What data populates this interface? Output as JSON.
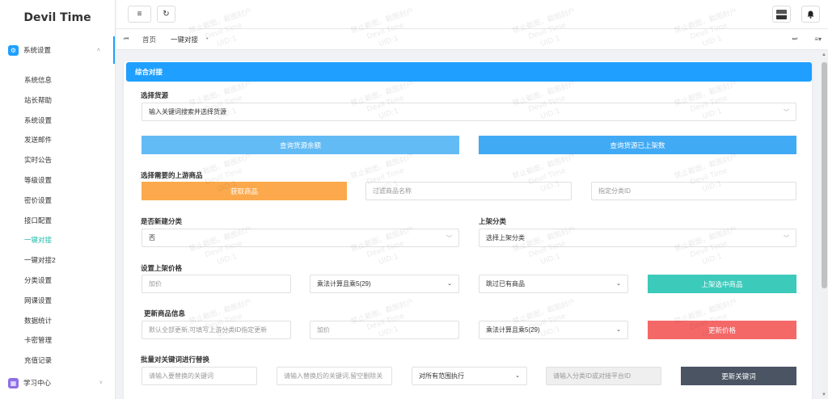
{
  "sidebar": {
    "brand": "Devil Time",
    "group_system": {
      "label": "系统设置",
      "icon": "gear-icon"
    },
    "items": [
      {
        "label": "系统信息"
      },
      {
        "label": "站长帮助"
      },
      {
        "label": "系统设置"
      },
      {
        "label": "发送邮件"
      },
      {
        "label": "实时公告"
      },
      {
        "label": "等级设置"
      },
      {
        "label": "密价设置"
      },
      {
        "label": "接口配置"
      },
      {
        "label": "一键对接",
        "active": true
      },
      {
        "label": "一键对接2"
      },
      {
        "label": "分类设置"
      },
      {
        "label": "网课设置"
      },
      {
        "label": "数据统计"
      },
      {
        "label": "卡密管理"
      },
      {
        "label": "充值记录"
      }
    ],
    "group_learning": {
      "label": "学习中心",
      "icon": "grid-icon"
    }
  },
  "header": {
    "menu_icon": "≡",
    "refresh_icon": "↻"
  },
  "tabs": {
    "home": "首页",
    "current": "一键对接",
    "close": "•",
    "prev_icon": "⏮",
    "next_icon": "⏭",
    "more_icon": "≡▾"
  },
  "panel": {
    "title": "综合对接",
    "source": {
      "label": "选择货源",
      "value": "输入关键词搜索并选择货源",
      "btn_balance": "查询货源余额",
      "btn_listed": "查询货源已上架数"
    },
    "upstream": {
      "label": "选择需要的上游商品",
      "btn_fetch": "获取商品",
      "filter_placeholder": "过滤商品名称",
      "category_placeholder": "指定分类ID"
    },
    "new_category": {
      "label": "是否新建分类",
      "value": "否"
    },
    "shelf_category": {
      "label": "上架分类",
      "value": "选择上架分类"
    },
    "price": {
      "label": "设置上架价格",
      "markup_placeholder": "加价",
      "method": "乘法计算且乘5(29)",
      "existing": "跳过已有商品",
      "btn_shelve": "上架选中商品"
    },
    "update": {
      "label": "更新商品信息",
      "ids_placeholder": "默认全部更新,可填写上游分类ID指定更新",
      "markup_placeholder": "加价",
      "method": "乘法计算且乘5(29)",
      "btn_update_price": "更新价格"
    },
    "keywords": {
      "label": "批量对关键词进行替换",
      "find_placeholder": "请输入要替换的关键词",
      "replace_placeholder": "请输入替换后的关键词,留空删除关",
      "scope": "对所有范围执行",
      "ids_placeholder": "请输入分类ID或对接平台ID",
      "btn_update_keywords": "更新关键词"
    }
  },
  "watermark": {
    "line1": "禁止截图，截图封户",
    "line2": "Devil Time",
    "line3": "UID:1"
  },
  "colors": {
    "primary": "#1f9fff",
    "light_blue": "#63bbf5",
    "blue": "#41aaf5",
    "orange": "#fba94c",
    "teal": "#3ccabb",
    "red": "#f56868",
    "dark": "#4b5463",
    "active_text": "#1fb8a6"
  }
}
